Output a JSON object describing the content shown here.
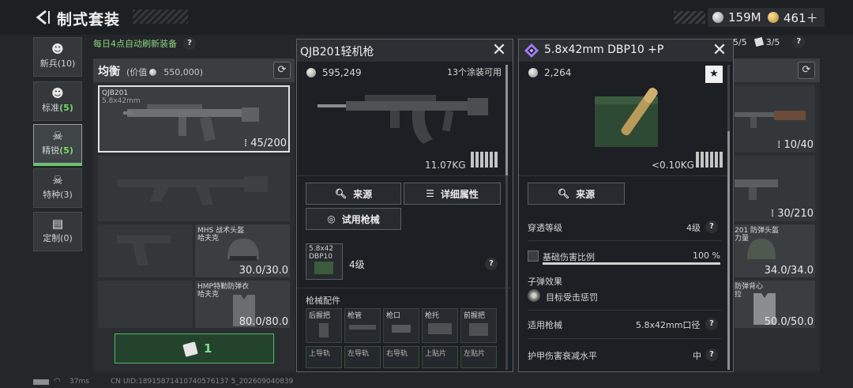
{
  "header": {
    "title": "制式套装",
    "currency_silver": "159M",
    "currency_gold": "461＋"
  },
  "tabs": [
    {
      "label": "新兵",
      "count": "(10)"
    },
    {
      "label": "标准",
      "count": "(5)"
    },
    {
      "label": "精锐",
      "count": "(5)"
    },
    {
      "label": "特种",
      "count": "(3)"
    },
    {
      "label": "定制",
      "count": "(0)"
    }
  ],
  "refresh_note": "每日4点自动刷新装备",
  "loadout_left": {
    "title": "均衡",
    "value_prefix": "(价值",
    "value": "550,000)",
    "primary": {
      "name": "QJB201",
      "caliber": "5.8x42mm",
      "ammo": "45/200"
    },
    "helmet": {
      "name": "MHS 战术头盔",
      "brand": "哈夫克",
      "durability": "30.0/30.0"
    },
    "armor": {
      "name": "HMP特勤防弹衣",
      "brand": "哈夫克",
      "durability": "80.0/80.0"
    },
    "green_count": "1"
  },
  "loadout_right": {
    "top_counts": [
      "5/5",
      "3/5"
    ],
    "primary_ammo": "10/40",
    "secondary_ammo": "30/210",
    "helmet_partial": "201 防弹头盔",
    "helmet_brand_partial": "力量",
    "helmet_durability": "34.0/34.0",
    "armor_partial": "防弹背心",
    "armor_brand_partial": "拉",
    "armor_durability": "50.0/50.0"
  },
  "weapon_popup": {
    "title": "QJB201轻机枪",
    "price": "595,249",
    "skins": "13个涂装可用",
    "weight": "11.07KG",
    "buttons": {
      "source": "来源",
      "details": "详细属性",
      "trial": "试用枪械"
    },
    "ammo_slot": {
      "label_line1": "5.8x42",
      "label_line2": "DBP10",
      "level": "4级"
    },
    "parts_title": "枪械配件",
    "parts_row1": [
      "后握把",
      "枪管",
      "枪口",
      "枪托",
      "前握把"
    ],
    "parts_row2": [
      "上导轨",
      "左导轨",
      "右导轨",
      "上贴片",
      "左贴片"
    ]
  },
  "ammo_popup": {
    "title": "5.8x42mm DBP10 +P",
    "price": "2,264",
    "weight": "<0.10KG",
    "source": "来源",
    "penetration_label": "穿透等级",
    "penetration_value": "4级",
    "base_damage_label": "基础伤害比例",
    "base_damage_value": "100 %",
    "base_damage_fraction": 1.0,
    "effect_title": "子弹效果",
    "effect_text": "目标受击惩罚",
    "weapon_label": "适用枪械",
    "weapon_value": "5.8x42mm口径",
    "armor_label": "护甲伤害衰减水平",
    "armor_value": "中"
  },
  "footer": {
    "ping": "37ms",
    "uid": "CN UID:18915871410740576137 5_202609040839"
  },
  "colors": {
    "accent_green": "#5ec866",
    "ammo_purple": "#a27bff"
  }
}
